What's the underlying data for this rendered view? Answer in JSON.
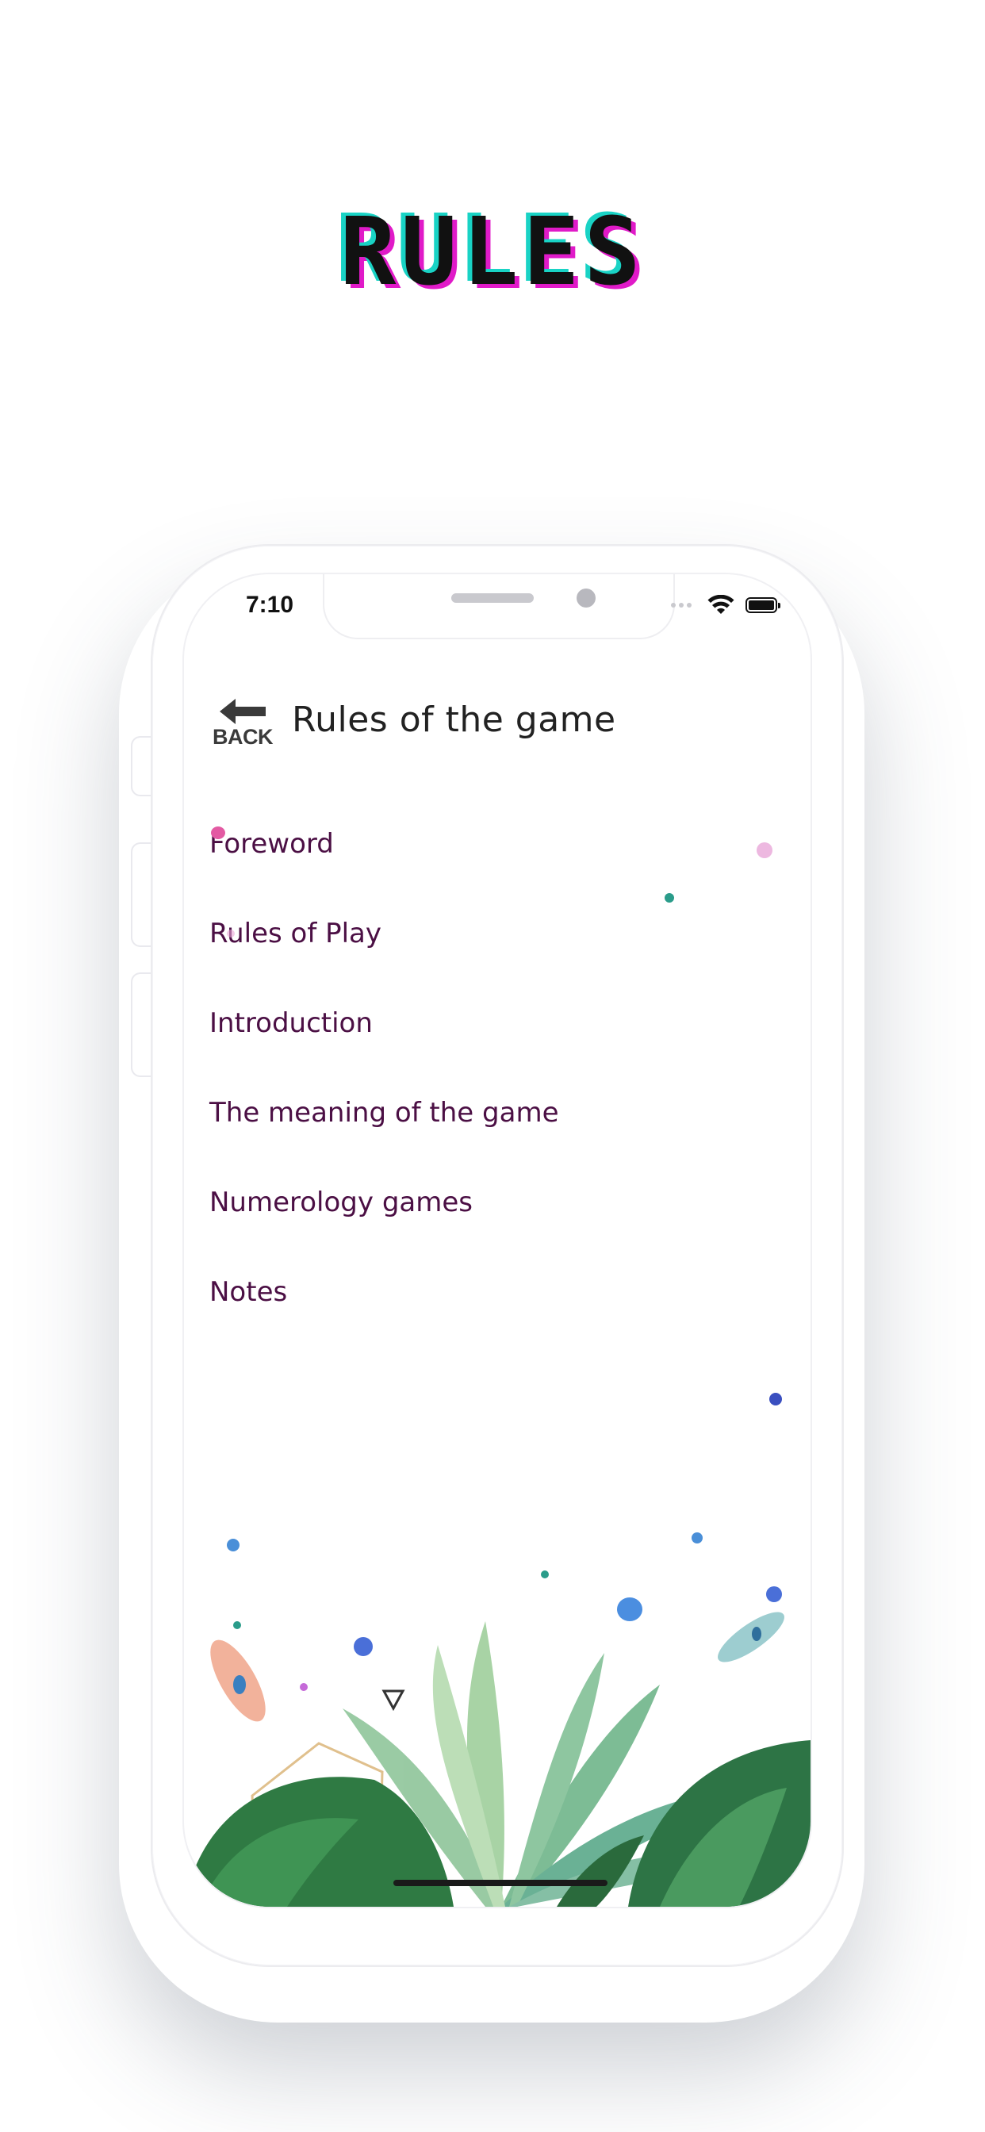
{
  "hero": {
    "title": "RULES"
  },
  "status_bar": {
    "time": "7:10"
  },
  "header": {
    "back_label": "BACK",
    "title": "Rules of the game"
  },
  "menu": {
    "items": [
      {
        "label": "Foreword"
      },
      {
        "label": "Rules of Play"
      },
      {
        "label": "Introduction"
      },
      {
        "label": "The meaning of the game"
      },
      {
        "label": "Numerology games"
      },
      {
        "label": "Notes"
      }
    ]
  },
  "colors": {
    "menu_text": "#4b0f44",
    "glitch_cyan": "#19d3c5",
    "glitch_magenta": "#e01ac8"
  },
  "icons": [
    "back-arrow-icon",
    "wifi-icon",
    "battery-icon",
    "speaker-grille",
    "front-camera"
  ]
}
